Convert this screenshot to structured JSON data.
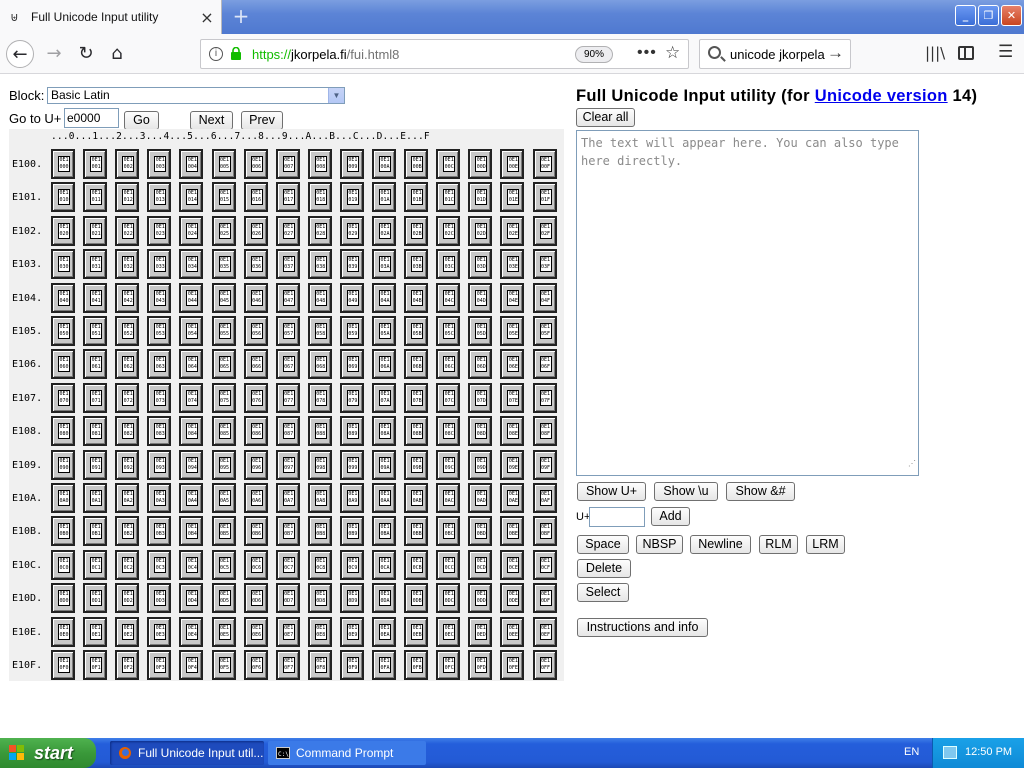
{
  "browser": {
    "tab_title": "Full Unicode Input utility",
    "tab_close": "×",
    "new_tab": "+",
    "url_https": "https://",
    "url_host": "jkorpela.fi",
    "url_path": "/fui.html8",
    "zoom": "90%",
    "page_actions": "•••",
    "search_text": "unicode jkorpela",
    "window_minimize": "_",
    "window_maximize": "❐",
    "window_close": "✕"
  },
  "page": {
    "block_label": "Block:",
    "block_selected": "Basic Latin",
    "goto_label": "Go to U+",
    "goto_value": "e0000",
    "go_button": "Go",
    "next_button": "Next",
    "prev_button": "Prev",
    "col_headers": "...0...1...2...3...4...5...6...7...8...9...A...B...C...D...E...F",
    "row_labels": [
      "E100.",
      "E101.",
      "E102.",
      "E103.",
      "E104.",
      "E105.",
      "E106.",
      "E107.",
      "E108.",
      "E109.",
      "E10A.",
      "E10B.",
      "E10C.",
      "E10D.",
      "E10E.",
      "E10F."
    ],
    "title_prefix": "Full Unicode Input utility (for ",
    "title_link": "Unicode version",
    "title_suffix": " 14)",
    "clear_button": "Clear all",
    "textarea_placeholder": "The text will appear here. You can also type here directly.",
    "show_uplus_button": "Show U+",
    "show_backslash_u_button": "Show \\u",
    "show_amp_button": "Show &#",
    "uplus_label": "U+",
    "add_button": "Add",
    "space_button": "Space",
    "nbsp_button": "NBSP",
    "newline_button": "Newline",
    "rlm_button": "RLM",
    "lrm_button": "LRM",
    "delete_button": "Delete",
    "select_button": "Select",
    "instructions_button": "Instructions and info"
  },
  "taskbar": {
    "start_label": "start",
    "tasks": [
      {
        "label": "Full Unicode Input util..."
      },
      {
        "label": "Command Prompt"
      }
    ],
    "language": "EN",
    "clock": "12:50 PM"
  },
  "colors": {
    "link": "#0000ee",
    "https_green": "#12bc00",
    "taskbar_blue": "#245edb",
    "start_green": "#3a993a"
  }
}
